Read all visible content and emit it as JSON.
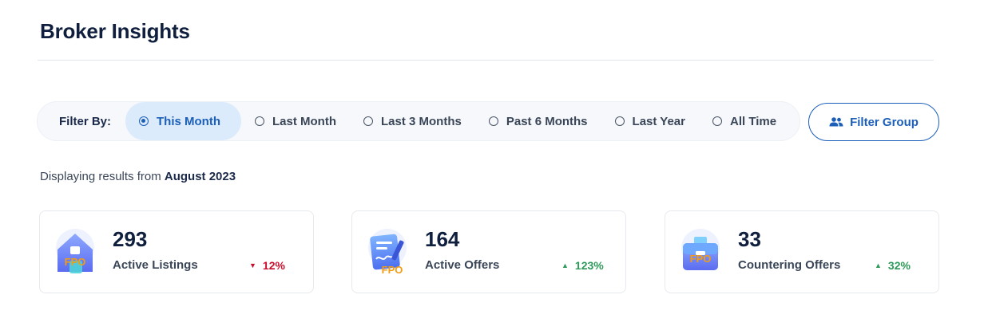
{
  "page": {
    "title": "Broker Insights"
  },
  "filter": {
    "label": "Filter By:",
    "options": [
      "This Month",
      "Last Month",
      "Last 3 Months",
      "Past 6 Months",
      "Last Year",
      "All Time"
    ],
    "selected": "This Month",
    "group_button": "Filter Group"
  },
  "results": {
    "prefix": "Displaying results from",
    "period": "August 2023"
  },
  "cards": [
    {
      "value": "293",
      "label": "Active Listings",
      "change": "12%",
      "trend": "down",
      "icon": "house-icon",
      "placeholder": "FPO"
    },
    {
      "value": "164",
      "label": "Active Offers",
      "change": "123%",
      "trend": "up",
      "icon": "document-icon",
      "placeholder": "FPO"
    },
    {
      "value": "33",
      "label": "Countering Offers",
      "change": "32%",
      "trend": "up",
      "icon": "briefcase-icon",
      "placeholder": "FPO"
    }
  ],
  "colors": {
    "accent": "#1c5fb8",
    "selected_bg": "#dcebfb",
    "down": "#c8102e",
    "up": "#2e9a5a",
    "fpo": "#f39c12"
  }
}
